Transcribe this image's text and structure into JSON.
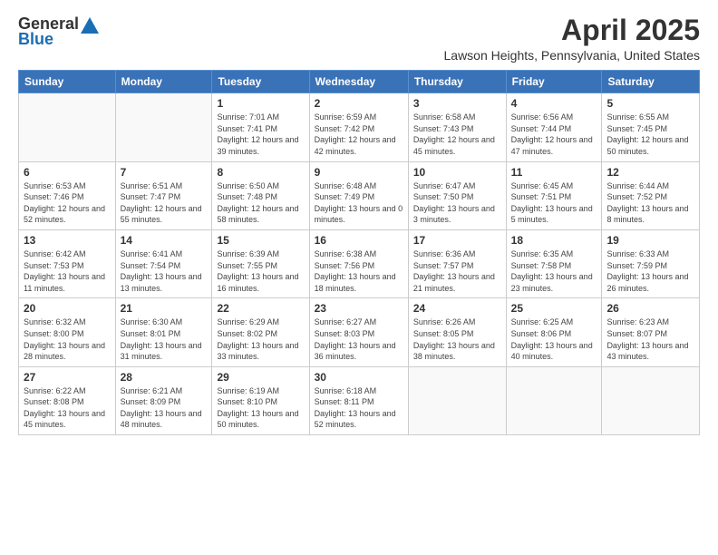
{
  "logo": {
    "general": "General",
    "blue": "Blue"
  },
  "title": "April 2025",
  "location": "Lawson Heights, Pennsylvania, United States",
  "days_of_week": [
    "Sunday",
    "Monday",
    "Tuesday",
    "Wednesday",
    "Thursday",
    "Friday",
    "Saturday"
  ],
  "weeks": [
    [
      {
        "day": "",
        "sunrise": "",
        "sunset": "",
        "daylight": ""
      },
      {
        "day": "",
        "sunrise": "",
        "sunset": "",
        "daylight": ""
      },
      {
        "day": "1",
        "sunrise": "Sunrise: 7:01 AM",
        "sunset": "Sunset: 7:41 PM",
        "daylight": "Daylight: 12 hours and 39 minutes."
      },
      {
        "day": "2",
        "sunrise": "Sunrise: 6:59 AM",
        "sunset": "Sunset: 7:42 PM",
        "daylight": "Daylight: 12 hours and 42 minutes."
      },
      {
        "day": "3",
        "sunrise": "Sunrise: 6:58 AM",
        "sunset": "Sunset: 7:43 PM",
        "daylight": "Daylight: 12 hours and 45 minutes."
      },
      {
        "day": "4",
        "sunrise": "Sunrise: 6:56 AM",
        "sunset": "Sunset: 7:44 PM",
        "daylight": "Daylight: 12 hours and 47 minutes."
      },
      {
        "day": "5",
        "sunrise": "Sunrise: 6:55 AM",
        "sunset": "Sunset: 7:45 PM",
        "daylight": "Daylight: 12 hours and 50 minutes."
      }
    ],
    [
      {
        "day": "6",
        "sunrise": "Sunrise: 6:53 AM",
        "sunset": "Sunset: 7:46 PM",
        "daylight": "Daylight: 12 hours and 52 minutes."
      },
      {
        "day": "7",
        "sunrise": "Sunrise: 6:51 AM",
        "sunset": "Sunset: 7:47 PM",
        "daylight": "Daylight: 12 hours and 55 minutes."
      },
      {
        "day": "8",
        "sunrise": "Sunrise: 6:50 AM",
        "sunset": "Sunset: 7:48 PM",
        "daylight": "Daylight: 12 hours and 58 minutes."
      },
      {
        "day": "9",
        "sunrise": "Sunrise: 6:48 AM",
        "sunset": "Sunset: 7:49 PM",
        "daylight": "Daylight: 13 hours and 0 minutes."
      },
      {
        "day": "10",
        "sunrise": "Sunrise: 6:47 AM",
        "sunset": "Sunset: 7:50 PM",
        "daylight": "Daylight: 13 hours and 3 minutes."
      },
      {
        "day": "11",
        "sunrise": "Sunrise: 6:45 AM",
        "sunset": "Sunset: 7:51 PM",
        "daylight": "Daylight: 13 hours and 5 minutes."
      },
      {
        "day": "12",
        "sunrise": "Sunrise: 6:44 AM",
        "sunset": "Sunset: 7:52 PM",
        "daylight": "Daylight: 13 hours and 8 minutes."
      }
    ],
    [
      {
        "day": "13",
        "sunrise": "Sunrise: 6:42 AM",
        "sunset": "Sunset: 7:53 PM",
        "daylight": "Daylight: 13 hours and 11 minutes."
      },
      {
        "day": "14",
        "sunrise": "Sunrise: 6:41 AM",
        "sunset": "Sunset: 7:54 PM",
        "daylight": "Daylight: 13 hours and 13 minutes."
      },
      {
        "day": "15",
        "sunrise": "Sunrise: 6:39 AM",
        "sunset": "Sunset: 7:55 PM",
        "daylight": "Daylight: 13 hours and 16 minutes."
      },
      {
        "day": "16",
        "sunrise": "Sunrise: 6:38 AM",
        "sunset": "Sunset: 7:56 PM",
        "daylight": "Daylight: 13 hours and 18 minutes."
      },
      {
        "day": "17",
        "sunrise": "Sunrise: 6:36 AM",
        "sunset": "Sunset: 7:57 PM",
        "daylight": "Daylight: 13 hours and 21 minutes."
      },
      {
        "day": "18",
        "sunrise": "Sunrise: 6:35 AM",
        "sunset": "Sunset: 7:58 PM",
        "daylight": "Daylight: 13 hours and 23 minutes."
      },
      {
        "day": "19",
        "sunrise": "Sunrise: 6:33 AM",
        "sunset": "Sunset: 7:59 PM",
        "daylight": "Daylight: 13 hours and 26 minutes."
      }
    ],
    [
      {
        "day": "20",
        "sunrise": "Sunrise: 6:32 AM",
        "sunset": "Sunset: 8:00 PM",
        "daylight": "Daylight: 13 hours and 28 minutes."
      },
      {
        "day": "21",
        "sunrise": "Sunrise: 6:30 AM",
        "sunset": "Sunset: 8:01 PM",
        "daylight": "Daylight: 13 hours and 31 minutes."
      },
      {
        "day": "22",
        "sunrise": "Sunrise: 6:29 AM",
        "sunset": "Sunset: 8:02 PM",
        "daylight": "Daylight: 13 hours and 33 minutes."
      },
      {
        "day": "23",
        "sunrise": "Sunrise: 6:27 AM",
        "sunset": "Sunset: 8:03 PM",
        "daylight": "Daylight: 13 hours and 36 minutes."
      },
      {
        "day": "24",
        "sunrise": "Sunrise: 6:26 AM",
        "sunset": "Sunset: 8:05 PM",
        "daylight": "Daylight: 13 hours and 38 minutes."
      },
      {
        "day": "25",
        "sunrise": "Sunrise: 6:25 AM",
        "sunset": "Sunset: 8:06 PM",
        "daylight": "Daylight: 13 hours and 40 minutes."
      },
      {
        "day": "26",
        "sunrise": "Sunrise: 6:23 AM",
        "sunset": "Sunset: 8:07 PM",
        "daylight": "Daylight: 13 hours and 43 minutes."
      }
    ],
    [
      {
        "day": "27",
        "sunrise": "Sunrise: 6:22 AM",
        "sunset": "Sunset: 8:08 PM",
        "daylight": "Daylight: 13 hours and 45 minutes."
      },
      {
        "day": "28",
        "sunrise": "Sunrise: 6:21 AM",
        "sunset": "Sunset: 8:09 PM",
        "daylight": "Daylight: 13 hours and 48 minutes."
      },
      {
        "day": "29",
        "sunrise": "Sunrise: 6:19 AM",
        "sunset": "Sunset: 8:10 PM",
        "daylight": "Daylight: 13 hours and 50 minutes."
      },
      {
        "day": "30",
        "sunrise": "Sunrise: 6:18 AM",
        "sunset": "Sunset: 8:11 PM",
        "daylight": "Daylight: 13 hours and 52 minutes."
      },
      {
        "day": "",
        "sunrise": "",
        "sunset": "",
        "daylight": ""
      },
      {
        "day": "",
        "sunrise": "",
        "sunset": "",
        "daylight": ""
      },
      {
        "day": "",
        "sunrise": "",
        "sunset": "",
        "daylight": ""
      }
    ]
  ]
}
